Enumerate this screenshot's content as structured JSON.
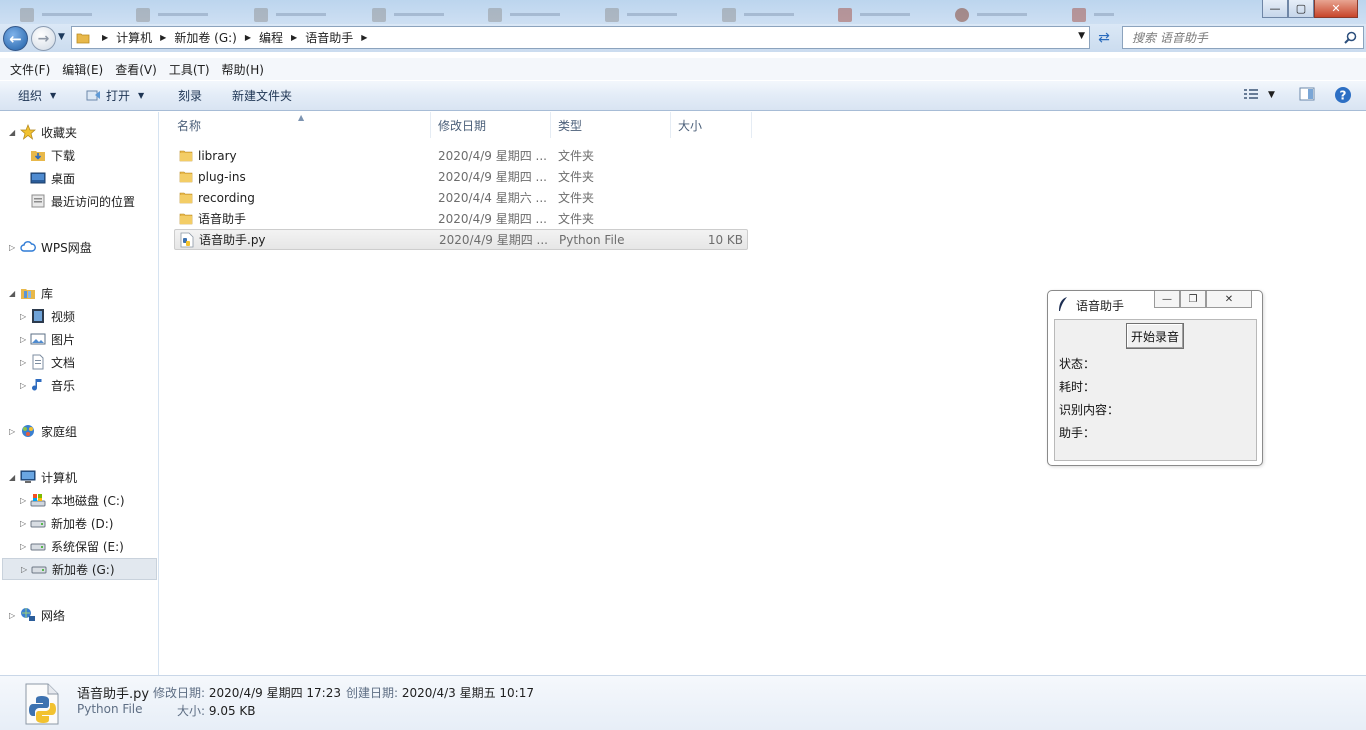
{
  "window": {
    "controls": {
      "minimize": "—",
      "maximize": "▢",
      "close": "✕"
    }
  },
  "address": {
    "crumbs": [
      "计算机",
      "新加卷 (G:)",
      "编程",
      "语音助手"
    ],
    "search_placeholder": "搜索 语音助手"
  },
  "menubar": {
    "items": [
      "文件(F)",
      "编辑(E)",
      "查看(V)",
      "工具(T)",
      "帮助(H)"
    ]
  },
  "toolbar": {
    "organize": "组织",
    "open": "打开",
    "burn": "刻录",
    "new_folder": "新建文件夹"
  },
  "navpane": {
    "favorites": "收藏夹",
    "downloads": "下载",
    "desktop": "桌面",
    "recent": "最近访问的位置",
    "wps": "WPS网盘",
    "libraries": "库",
    "videos": "视频",
    "pictures": "图片",
    "documents": "文档",
    "music": "音乐",
    "homegroup": "家庭组",
    "computer": "计算机",
    "drive_c": "本地磁盘 (C:)",
    "drive_d": "新加卷 (D:)",
    "drive_e": "系统保留 (E:)",
    "drive_g": "新加卷 (G:)",
    "network": "网络"
  },
  "columns": {
    "name": "名称",
    "date": "修改日期",
    "type": "类型",
    "size": "大小"
  },
  "files": [
    {
      "name": "library",
      "date": "2020/4/9 星期四 ...",
      "type": "文件夹",
      "size": ""
    },
    {
      "name": "plug-ins",
      "date": "2020/4/9 星期四 ...",
      "type": "文件夹",
      "size": ""
    },
    {
      "name": "recording",
      "date": "2020/4/4 星期六 ...",
      "type": "文件夹",
      "size": ""
    },
    {
      "name": "语音助手",
      "date": "2020/4/9 星期四 ...",
      "type": "文件夹",
      "size": ""
    },
    {
      "name": "语音助手.py",
      "date": "2020/4/9 星期四 ...",
      "type": "Python File",
      "size": "10 KB"
    }
  ],
  "details": {
    "name": "语音助手.py",
    "type": "Python File",
    "modified_label": "修改日期:",
    "modified": "2020/4/9 星期四 17:23",
    "created_label": "创建日期:",
    "created": "2020/4/3 星期五 10:17",
    "size_label": "大小:",
    "size": "9.05 KB"
  },
  "app": {
    "title": "语音助手",
    "record_button": "开始录音",
    "status_label": "状态：",
    "elapsed_label": "耗时：",
    "recognized_label": "识别内容：",
    "assistant_label": "助手："
  }
}
